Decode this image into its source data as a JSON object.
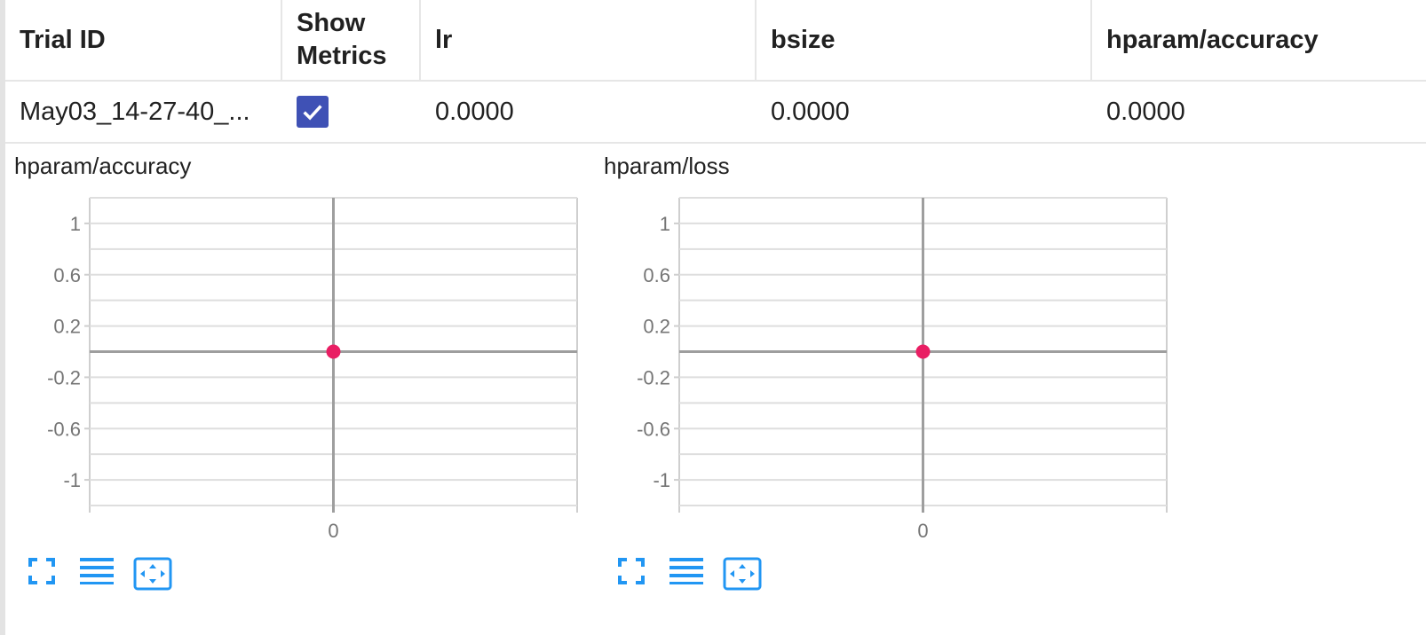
{
  "table": {
    "headers": {
      "trial_id": "Trial ID",
      "show_metrics_line1": "Show",
      "show_metrics_line2": "Metrics",
      "lr": "lr",
      "bsize": "bsize",
      "accuracy": "hparam/accuracy"
    },
    "rows": [
      {
        "trial_id": "May03_14-27-40_...",
        "show_metrics": true,
        "lr": "0.0000",
        "bsize": "0.0000",
        "accuracy": "0.0000"
      }
    ]
  },
  "chart_data": [
    {
      "type": "scatter",
      "title": "hparam/accuracy",
      "x": [
        0
      ],
      "y": [
        0
      ],
      "xlim": [
        -1,
        1
      ],
      "ylim": [
        -1.2,
        1.2
      ],
      "xticks": [
        0
      ],
      "yticks": [
        1,
        0.6,
        0.2,
        -0.2,
        -0.6,
        -1
      ],
      "point_color": "#e91e63",
      "grid": true
    },
    {
      "type": "scatter",
      "title": "hparam/loss",
      "x": [
        0
      ],
      "y": [
        0
      ],
      "xlim": [
        -1,
        1
      ],
      "ylim": [
        -1.2,
        1.2
      ],
      "xticks": [
        0
      ],
      "yticks": [
        1,
        0.6,
        0.2,
        -0.2,
        -0.6,
        -1
      ],
      "point_color": "#e91e63",
      "grid": true
    }
  ],
  "colors": {
    "accent": "#3f51b5",
    "tool": "#2196f3",
    "point": "#e91e63"
  },
  "icons": [
    "fullscreen-icon",
    "toggle-log-icon",
    "fit-domain-icon"
  ]
}
